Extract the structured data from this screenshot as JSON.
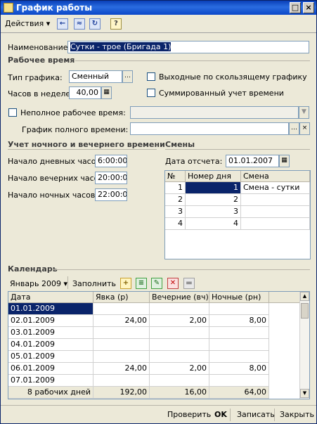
{
  "window": {
    "title": "График работы"
  },
  "toolbar": {
    "actions_label": "Действия",
    "help_label": "?"
  },
  "form": {
    "name_label": "Наименование:",
    "name_value": "Сутки - трое (Бригада 1)",
    "section_work_time": "Рабочее время",
    "schedule_type_label": "Тип графика:",
    "schedule_type_value": "Сменный",
    "hours_week_label": "Часов в неделе:",
    "hours_week_value": "40,00",
    "sliding_days_off_label": "Выходные по скользящему графику",
    "summarized_label": "Суммированный учет времени",
    "part_time_label": "Неполное рабочее время:",
    "full_time_schedule_label": "График полного времени:",
    "section_night": "Учет ночного и вечернего времени",
    "day_start_label": "Начало дневных часов:",
    "day_start_value": "6:00:00",
    "evening_start_label": "Начало вечерних часов:",
    "evening_start_value": "20:00:00",
    "night_start_label": "Начало ночных часов:",
    "night_start_value": "22:00:00",
    "section_shifts": "Смены",
    "ref_date_label": "Дата отсчета:",
    "ref_date_value": "01.01.2007"
  },
  "shifts": {
    "headers": [
      "№",
      "Номер дня",
      "Смена"
    ],
    "rows": [
      [
        "1",
        "1",
        "Смена - сутки"
      ],
      [
        "2",
        "2",
        ""
      ],
      [
        "3",
        "3",
        ""
      ],
      [
        "4",
        "4",
        ""
      ]
    ]
  },
  "calendar": {
    "section": "Календарь",
    "month_label": "Январь 2009",
    "fill_label": "Заполнить",
    "headers": [
      "Дата",
      "Явка (р)",
      "Вечерние (вч)",
      "Ночные (рн)"
    ],
    "rows": [
      [
        "01.01.2009",
        "",
        "",
        ""
      ],
      [
        "02.01.2009",
        "24,00",
        "2,00",
        "8,00"
      ],
      [
        "03.01.2009",
        "",
        "",
        ""
      ],
      [
        "04.01.2009",
        "",
        "",
        ""
      ],
      [
        "05.01.2009",
        "",
        "",
        ""
      ],
      [
        "06.01.2009",
        "24,00",
        "2,00",
        "8,00"
      ],
      [
        "07.01.2009",
        "",
        "",
        ""
      ]
    ],
    "footer": [
      "8 рабочих дней",
      "192,00",
      "16,00",
      "64,00"
    ]
  },
  "bottom": {
    "check": "Проверить",
    "ok": "OK",
    "write": "Записать",
    "close": "Закрыть"
  },
  "colors": {
    "accent": "#0a246a",
    "title_bar": "#0a3fb8",
    "window_bg": "#ece9d8"
  }
}
